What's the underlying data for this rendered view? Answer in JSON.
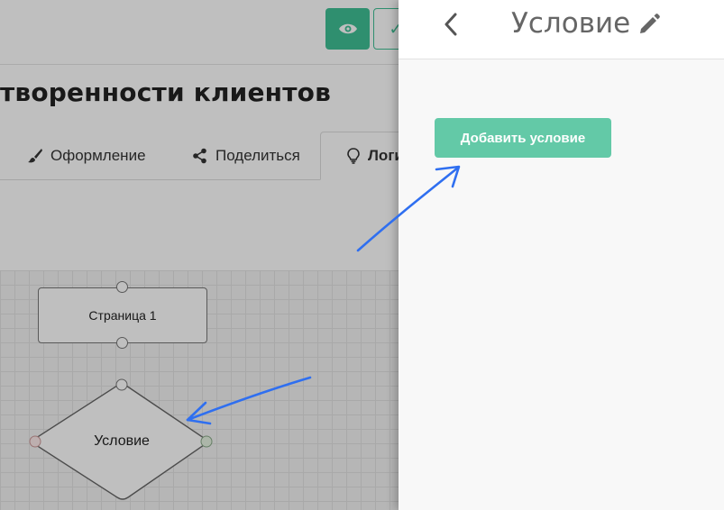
{
  "header": {
    "page_title": "творенности клиентов"
  },
  "tabs": [
    {
      "label": "Оформление",
      "icon": "brush-icon"
    },
    {
      "label": "Поделиться",
      "icon": "share-icon"
    },
    {
      "label": "Логи",
      "icon": "lightbulb-icon",
      "active": true
    }
  ],
  "canvas": {
    "page_node_label": "Страница 1",
    "condition_node_label": "Условие"
  },
  "panel": {
    "title": "Условие",
    "add_condition_label": "Добавить условие"
  },
  "colors": {
    "accent": "#63c9a7",
    "preview_button": "#3fbf94",
    "annotation_arrow": "#2f6ff0"
  }
}
